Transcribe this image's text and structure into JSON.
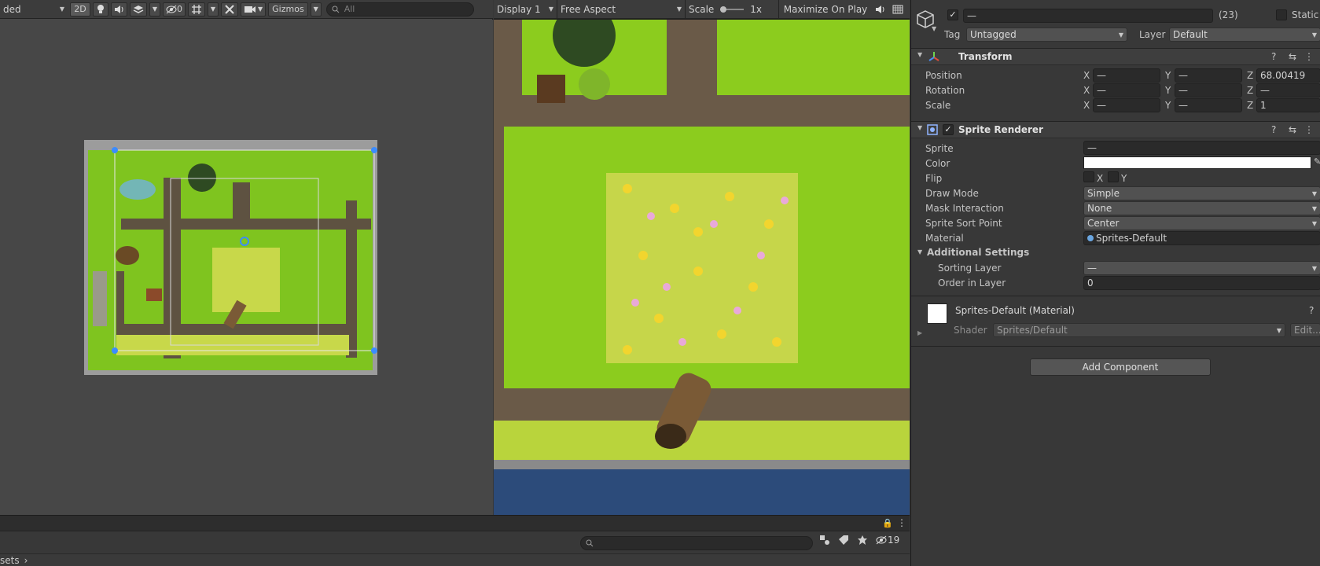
{
  "scene_toolbar": {
    "draw_mode": "ded",
    "mode_2d": "2D",
    "light_icon": "bulb-icon",
    "audio_icon": "speaker-icon",
    "effects_icon": "layers-icon",
    "hidden_count": "0",
    "grid_icon": "grid-icon",
    "tools_icon": "tools-icon",
    "camera_icon": "camera-icon",
    "gizmos_label": "Gizmos",
    "search_placeholder": "All"
  },
  "game_toolbar": {
    "display": "Display 1",
    "aspect": "Free Aspect",
    "scale_label": "Scale",
    "scale_value": "1x",
    "maximize": "Maximize On Play"
  },
  "inspector": {
    "object_name": "—",
    "object_count": "(23)",
    "static_label": "Static",
    "tag_label": "Tag",
    "tag_value": "Untagged",
    "layer_label": "Layer",
    "layer_value": "Default",
    "transform": {
      "title": "Transform",
      "position_label": "Position",
      "rotation_label": "Rotation",
      "scale_label": "Scale",
      "position": {
        "x": "—",
        "y": "—",
        "z": "68.00419"
      },
      "rotation": {
        "x": "—",
        "y": "—",
        "z": "—"
      },
      "scale": {
        "x": "—",
        "y": "—",
        "z": "1"
      }
    },
    "sprite_renderer": {
      "title": "Sprite Renderer",
      "sprite_label": "Sprite",
      "sprite_value": "—",
      "color_label": "Color",
      "color_value": "#ffffff",
      "flip_label": "Flip",
      "flip_x": "X",
      "flip_y": "Y",
      "draw_mode_label": "Draw Mode",
      "draw_mode_value": "Simple",
      "mask_label": "Mask Interaction",
      "mask_value": "None",
      "sort_point_label": "Sprite Sort Point",
      "sort_point_value": "Center",
      "material_label": "Material",
      "material_value": "Sprites-Default",
      "additional_label": "Additional Settings",
      "sorting_layer_label": "Sorting Layer",
      "sorting_layer_value": "—",
      "order_label": "Order in Layer",
      "order_value": "0"
    },
    "material": {
      "title": "Sprites-Default (Material)",
      "shader_label": "Shader",
      "shader_value": "Sprites/Default",
      "edit_label": "Edit..."
    },
    "add_component": "Add Component"
  },
  "project": {
    "search_placeholder": "",
    "hidden_count": "19",
    "breadcrumb": "sets"
  }
}
